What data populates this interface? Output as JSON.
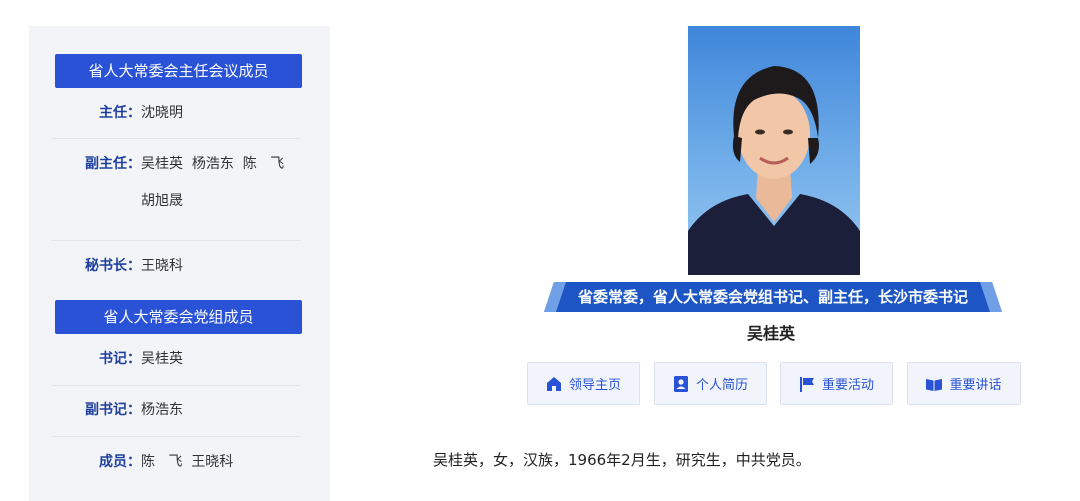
{
  "sidebar": {
    "section1_title": "省人大常委会主任会议成员",
    "director_label": "主任：",
    "director": "沈晓明",
    "vice_label": "副主任：",
    "vice_line1": "吴桂英  杨浩东  陈   飞",
    "vice_line2": "胡旭晟",
    "secretary_general_label": "秘书长：",
    "secretary_general": "王晓科",
    "section2_title": "省人大常委会党组成员",
    "party_secretary_label": "书记：",
    "party_secretary": "吴桂英",
    "deputy_secretary_label": "副书记：",
    "deputy_secretary": "杨浩东",
    "members_label": "成员：",
    "members": "陈   飞  王晓科"
  },
  "profile": {
    "title_banner": "省委常委，省人大常委会党组书记、副主任，长沙市委书记",
    "name": "吴桂英",
    "buttons": [
      {
        "label": "领导主页",
        "icon": "home-icon"
      },
      {
        "label": "个人简历",
        "icon": "profile-card-icon"
      },
      {
        "label": "重要活动",
        "icon": "flag-icon"
      },
      {
        "label": "重要讲话",
        "icon": "book-icon"
      }
    ],
    "intro": "吴桂英，女，汉族，1966年2月生，研究生，中共党员。"
  },
  "colors": {
    "accent": "#2a52d6",
    "label_blue": "#1f3f9e",
    "sidebar_bg": "#f2f4f7",
    "banner_blue": "#1d56c4"
  }
}
